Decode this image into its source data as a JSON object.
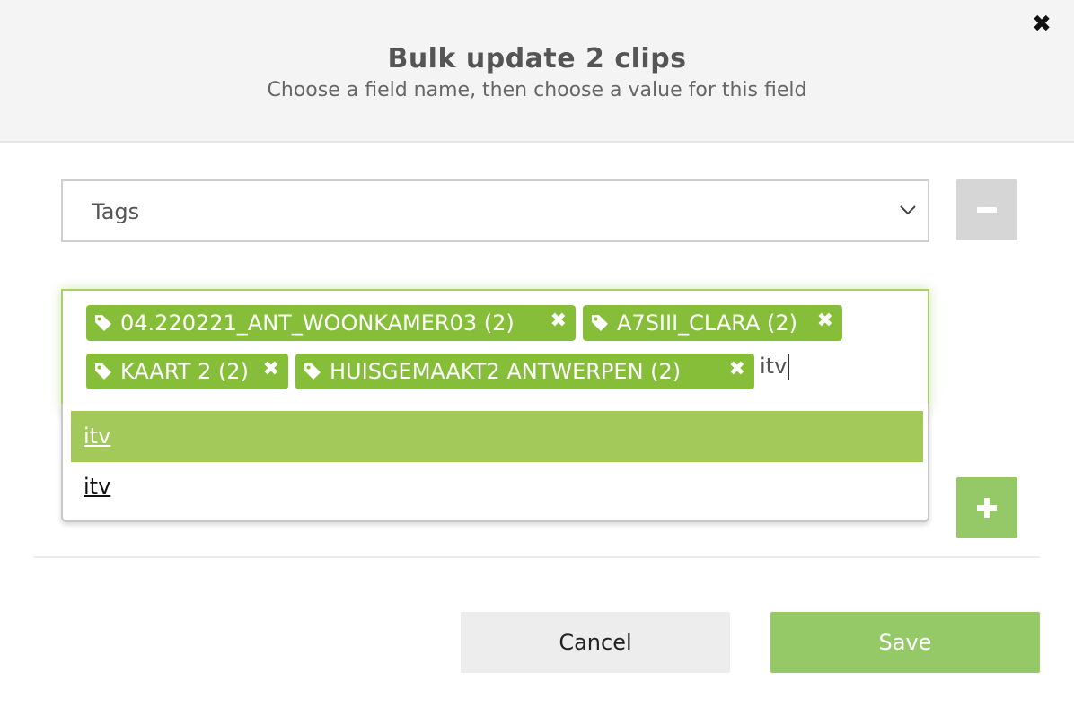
{
  "header": {
    "title": "Bulk update 2 clips",
    "subtitle": "Choose a field name, then choose a value for this field",
    "close_icon": "close-icon"
  },
  "field": {
    "selected": "Tags"
  },
  "tags": [
    {
      "label": "04.220221_ANT_WOONKAMER03 (2)",
      "remove": "✖"
    },
    {
      "label": "A7SIII_CLARA (2)",
      "remove": "✖"
    },
    {
      "label": "KAART 2 (2)",
      "remove": "✖"
    },
    {
      "label": "HUISGEMAAKT2 ANTWERPEN (2)",
      "remove": "✖"
    }
  ],
  "tag_input": {
    "value": "itv"
  },
  "suggestions": [
    {
      "label": "itv",
      "highlighted": true
    },
    {
      "label": "itv",
      "highlighted": false
    }
  ],
  "actions": {
    "cancel_label": "Cancel",
    "save_label": "Save"
  },
  "colors": {
    "accent": "#86be3a",
    "highlight": "#a2c95a",
    "save": "#95c866",
    "disabled": "#d6d6d6"
  }
}
